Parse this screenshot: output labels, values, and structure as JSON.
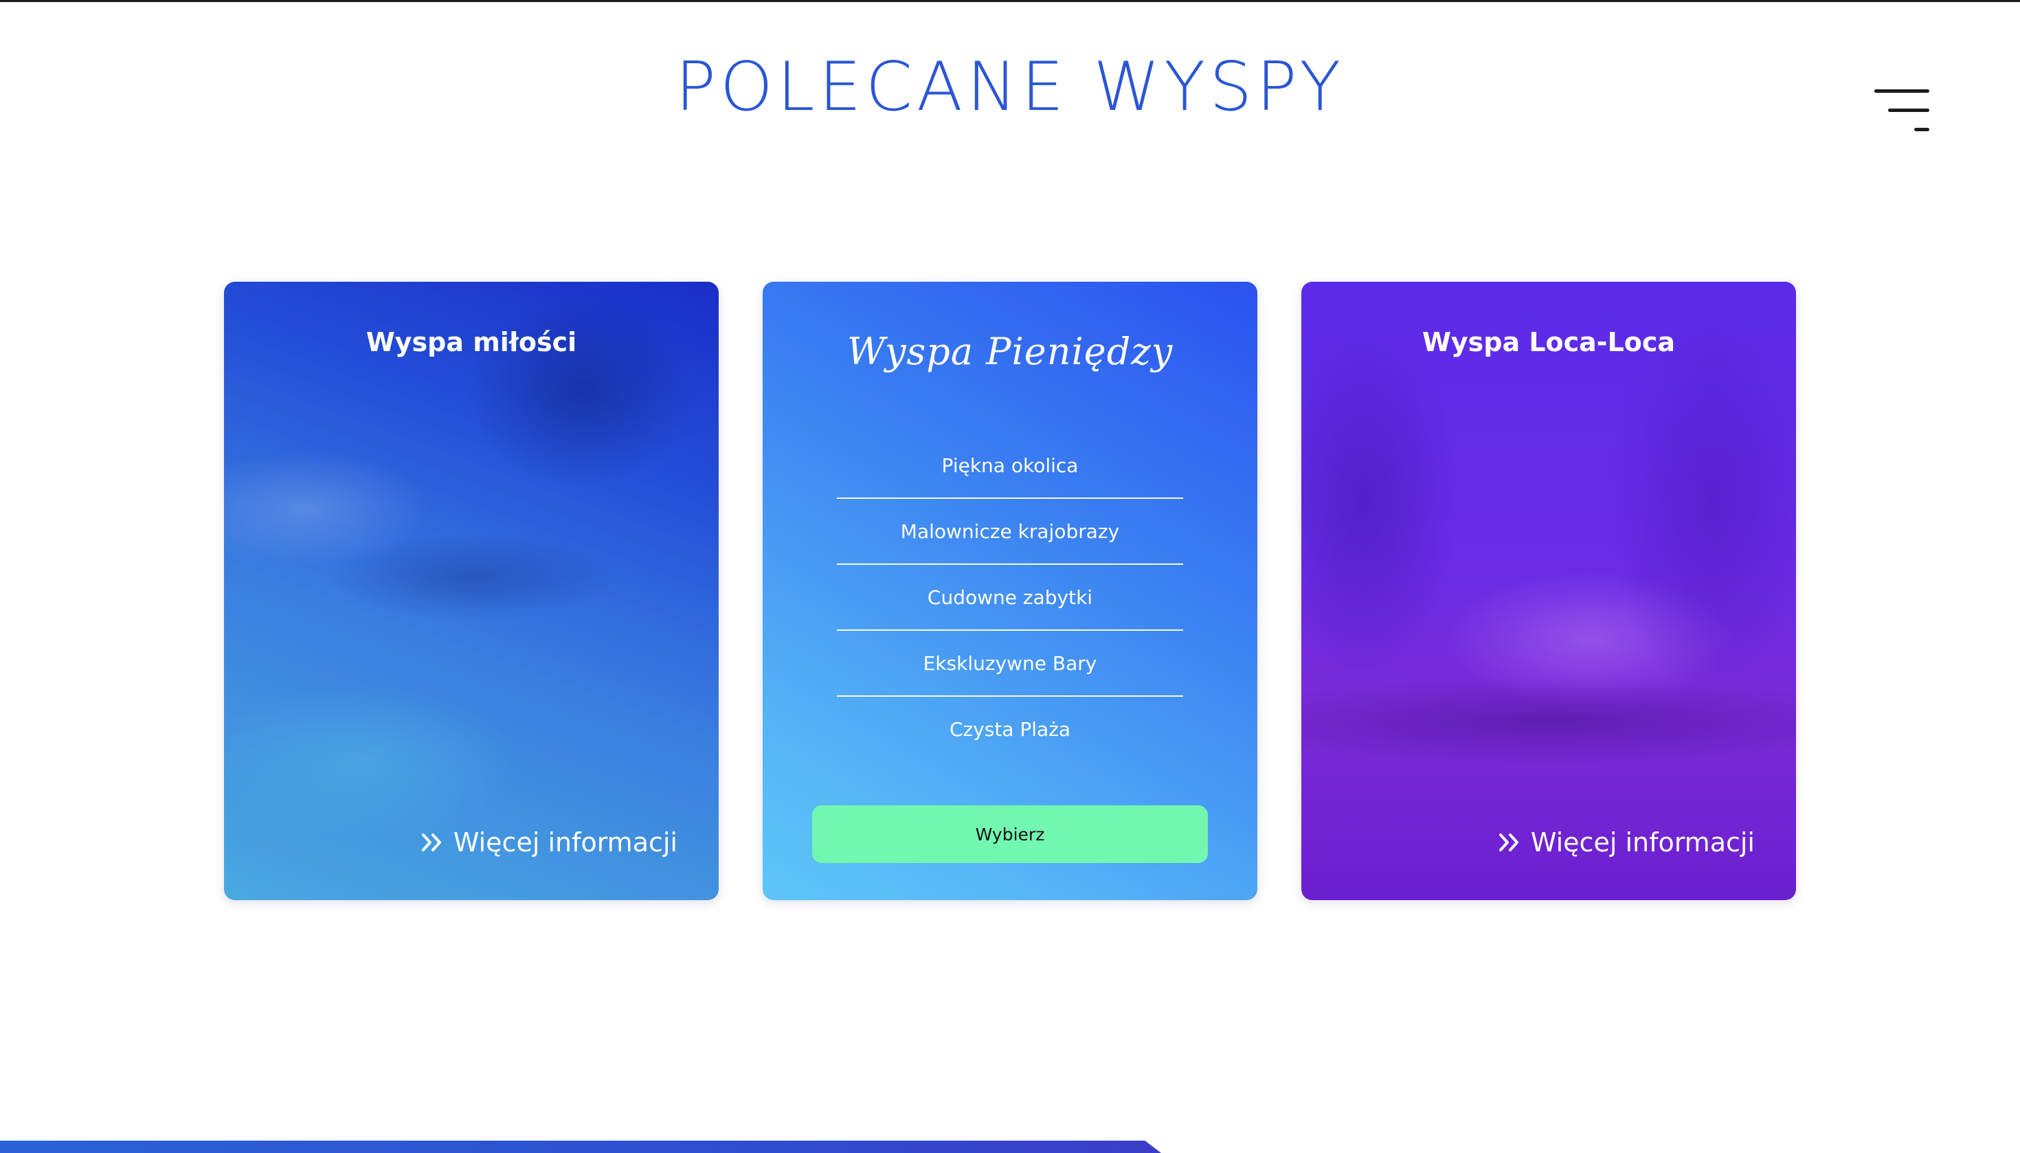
{
  "header": {
    "title": "POLECANE WYSPY",
    "menu_icon": "menu-icon",
    "accent_color": "#2a56d6"
  },
  "cards": [
    {
      "title": "Wyspa miłości",
      "link_label": "Więcej informacji",
      "link_icon": "double-chevron-right-icon"
    },
    {
      "title": "Wyspa Pieniędzy",
      "features": [
        "Piękna okolica",
        "Malownicze krajobrazy",
        "Cudowne zabytki",
        "Ekskluzywne Bary",
        "Czysta Plaża"
      ],
      "button_label": "Wybierz",
      "button_color": "#72f7b0"
    },
    {
      "title": "Wyspa Loca-Loca",
      "link_label": "Więcej informacji",
      "link_icon": "double-chevron-right-icon"
    }
  ]
}
